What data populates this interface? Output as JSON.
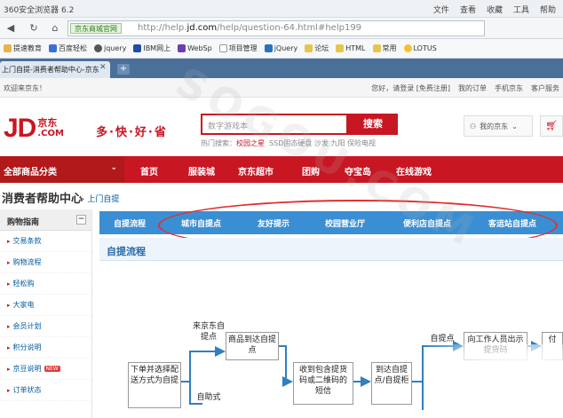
{
  "browser": {
    "title": "360安全浏览器 6.2",
    "menus": [
      "文件",
      "查看",
      "收藏",
      "工具",
      "帮助"
    ],
    "site_chip": "京东商城官网",
    "url_prefix": "http://help.",
    "url_domain": "jd.com",
    "url_suffix": "/help/question-64.html#help199",
    "bookmarks": [
      "提速教育",
      "百度轻松",
      "jquery",
      "IBM网上",
      "WebSp",
      "项目管理",
      "jQuery",
      "论坛",
      "HTML",
      "常用",
      "LOTUS"
    ],
    "tab_title": "上门自提-消费者帮助中心-京东",
    "new_tab": "+"
  },
  "topbar": {
    "welcome": "欢迎来京东！",
    "links": [
      "您好，请登录 [免费注册]",
      "我的订单",
      "手机京东",
      "客户服务"
    ]
  },
  "header": {
    "logo_text": "JD",
    "logo_sub": ".COM",
    "logo_cn": "京东",
    "slogan": "多·快·好·省",
    "search_placeholder": "数字游戏本",
    "search_button": "搜索",
    "hot_prefix": "热门搜索：",
    "hot_highlight": "校园之星",
    "hot_rest": "SSD固态硬盘  沙发  九阳  保险电视",
    "my_jd": "我的京东",
    "cart_icon": "cart-icon"
  },
  "mainnav": {
    "all_categories": "全部商品分类",
    "items": [
      "首页",
      "服装城",
      "京东超市",
      "团购",
      "夺宝岛",
      "在线游戏"
    ]
  },
  "breadcrumb": {
    "title": "消费者帮助中心",
    "sep": "> ",
    "current": "上门自提"
  },
  "sidebar": {
    "header": "购物指南",
    "toggle": "−",
    "items": [
      "交易条款",
      "购物流程",
      "轻松购",
      "大家电",
      "会员计划",
      "积分说明",
      "京豆说明",
      "订单状态"
    ],
    "new_badge": "NEW"
  },
  "tabs": [
    "自提流程",
    "城市自提点",
    "友好提示",
    "校园营业厅",
    "便利店自提点",
    "客运站自提点"
  ],
  "section_title": "自提流程",
  "flow": {
    "start": "下单并选择配送方式为自提",
    "branch_top": "来京东自提点",
    "branch_bottom": "自助式",
    "step_arrive": "商品到达自提点",
    "step_sms": "收到包含提货码或二维码的短信",
    "step_go": "到达自提点/自提柜",
    "branch_right": "自提点",
    "step_staff": "向工作人员出示提货码",
    "step_partial": "付"
  },
  "watermark": "SOGOU.COM"
}
